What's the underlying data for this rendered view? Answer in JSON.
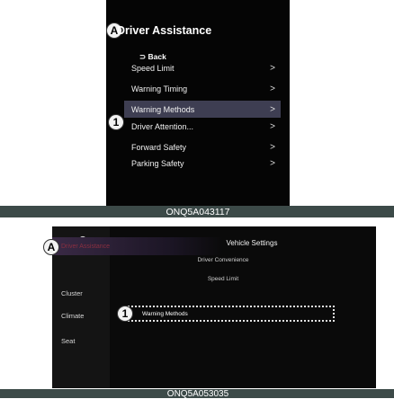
{
  "figure1": {
    "title": "Driver Assistance",
    "marker_a": "A",
    "back_label": "Back",
    "menu_items": [
      {
        "label": "Speed Limit",
        "selected": false
      },
      {
        "label": "Warning Timing",
        "selected": false
      },
      {
        "label": "Warning Methods",
        "selected": true
      },
      {
        "label": "Driver Attention...",
        "selected": false
      },
      {
        "label": "Forward Safety",
        "selected": false
      },
      {
        "label": "Parking Safety",
        "selected": false
      }
    ],
    "marker_1": "1",
    "caption": "ONQ5A043117"
  },
  "figure2": {
    "title": "Vehicle Settings",
    "marker_a": "A",
    "sidebar_items": [
      {
        "label": "Driver Assistance",
        "active": true
      },
      {
        "label": "Cluster",
        "active": false
      },
      {
        "label": "Climate",
        "active": false
      },
      {
        "label": "Seat",
        "active": false
      }
    ],
    "list_items": [
      "Driver Convenience",
      "Speed Limit"
    ],
    "selected_item": "Warning Methods",
    "marker_1": "1",
    "caption": "ONQ5A053035"
  },
  "colors": {
    "caption_bar": "#3c4a48",
    "screen_bg": "#050505",
    "selected_row": "#3e3e52",
    "active_sidebar_text": "#8a2f40"
  }
}
